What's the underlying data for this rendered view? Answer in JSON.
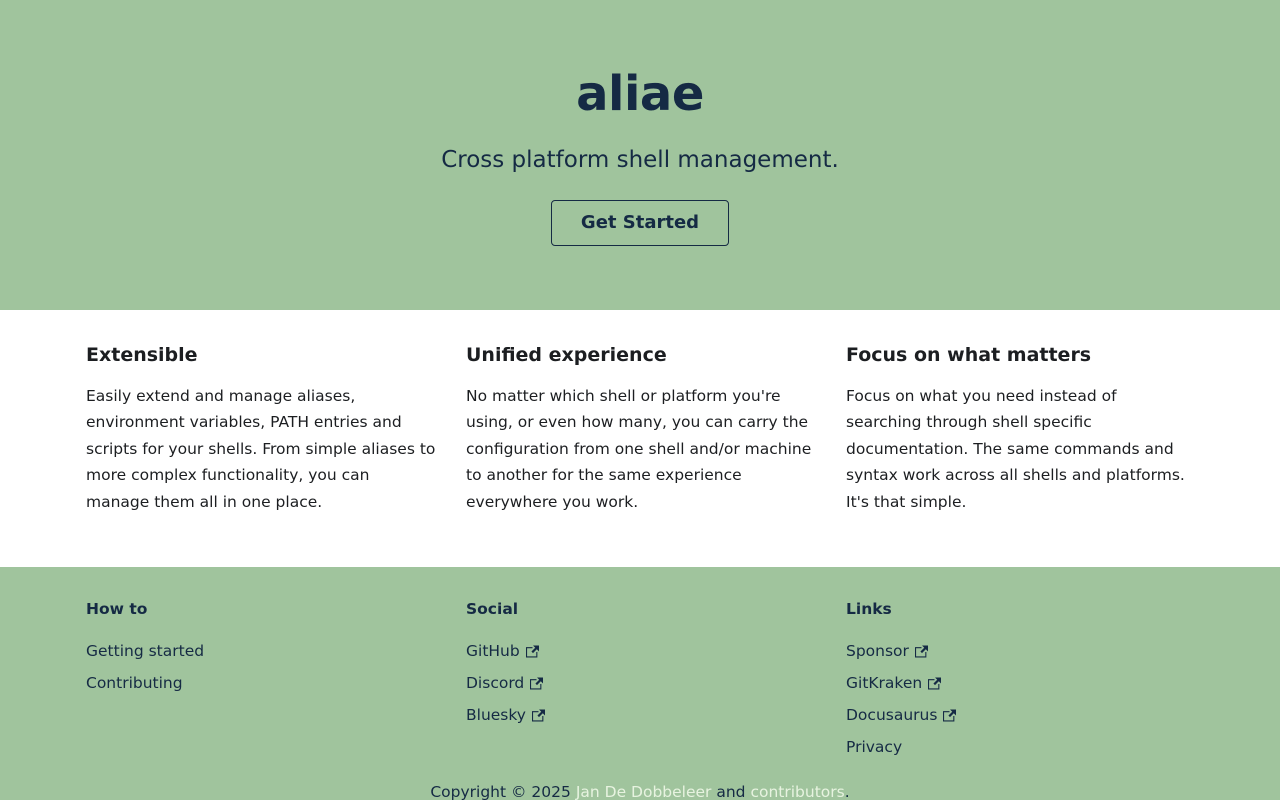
{
  "hero": {
    "title": "aliae",
    "subtitle": "Cross platform shell management.",
    "cta_label": "Get Started"
  },
  "features": [
    {
      "title": "Extensible",
      "text": "Easily extend and manage aliases, environment variables, PATH entries and scripts for your shells. From simple aliases to more complex functionality, you can manage them all in one place."
    },
    {
      "title": "Unified experience",
      "text": "No matter which shell or platform you're using, or even how many, you can carry the configuration from one shell and/or machine to another for the same experience everywhere you work."
    },
    {
      "title": "Focus on what matters",
      "text": "Focus on what you need instead of searching through shell specific documentation. The same commands and syntax work across all shells and platforms. It's that simple."
    }
  ],
  "footer": {
    "how_to": {
      "title": "How to",
      "links": [
        {
          "label": "Getting started"
        },
        {
          "label": "Contributing"
        }
      ]
    },
    "social": {
      "title": "Social",
      "links": [
        {
          "label": "GitHub",
          "icon": "external-link-icon"
        },
        {
          "label": "Discord",
          "icon": "external-link-icon"
        },
        {
          "label": "Bluesky",
          "icon": "external-link-icon"
        }
      ]
    },
    "links": {
      "title": "Links",
      "links": [
        {
          "label": "Sponsor",
          "icon": "external-link-icon"
        },
        {
          "label": "GitKraken",
          "icon": "external-link-icon"
        },
        {
          "label": "Docusaurus",
          "icon": "external-link-icon"
        },
        {
          "label": "Privacy"
        }
      ]
    },
    "copyright": {
      "prefix": "Copyright © 2025",
      "author": "Jan De Dobbeleer",
      "middle": "and",
      "contributors": "contributors",
      "suffix": "."
    }
  },
  "colors": {
    "brand_green": "#a0c49d",
    "navy": "#152a44",
    "link_light": "#e7f3e0"
  }
}
